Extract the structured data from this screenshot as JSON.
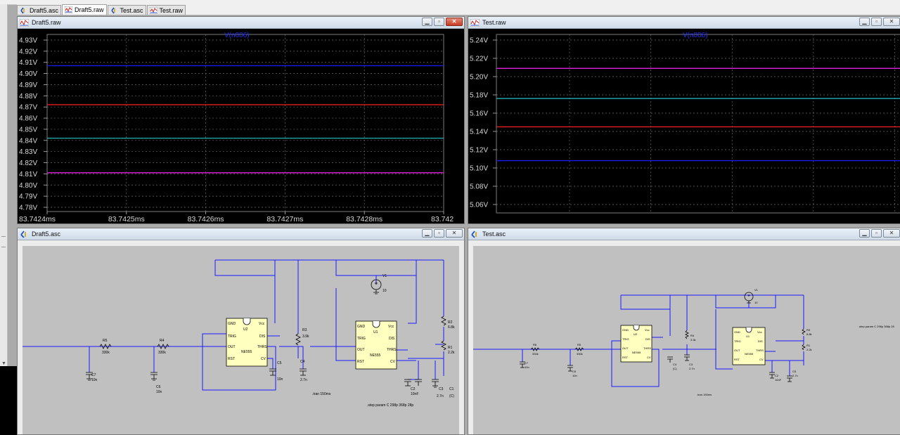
{
  "tabs": [
    {
      "label": "Draft5.asc",
      "icon": "schematic-icon",
      "active": false
    },
    {
      "label": "Draft5.raw",
      "icon": "waveform-icon",
      "active": true
    },
    {
      "label": "Test.asc",
      "icon": "schematic-icon",
      "active": false
    },
    {
      "label": "Test.raw",
      "icon": "waveform-icon",
      "active": false
    }
  ],
  "windows": {
    "draft5_raw": {
      "title": "Draft5.raw",
      "trace_label": "V(n006)"
    },
    "test_raw": {
      "title": "Test.raw",
      "trace_label": "V(n006)"
    },
    "draft5_asc": {
      "title": "Draft5.asc"
    },
    "test_asc": {
      "title": "Test.asc"
    }
  },
  "colors": {
    "trace_blue": "#1a1aff",
    "trace_red": "#ff2020",
    "trace_cyan": "#20b0b0",
    "trace_magenta": "#e020e0",
    "wire": "#1a1aff",
    "ic_fill": "#ffffbf",
    "background_plot": "#000000",
    "schematic_bg": "#c0c0c0"
  },
  "chart_data": [
    {
      "type": "line",
      "title": "V(n006)",
      "xlabel": "",
      "ylabel": "",
      "x_ticks": [
        "83.7424ms",
        "83.7425ms",
        "83.7426ms",
        "83.7427ms",
        "83.7428ms",
        "83.742"
      ],
      "y_ticks": [
        "4.93V",
        "4.92V",
        "4.91V",
        "4.90V",
        "4.89V",
        "4.88V",
        "4.87V",
        "4.86V",
        "4.85V",
        "4.84V",
        "4.83V",
        "4.82V",
        "4.81V",
        "4.80V",
        "4.79V",
        "4.78V"
      ],
      "ylim": [
        4.78,
        4.93
      ],
      "grid": true,
      "series": [
        {
          "color": "#1a1aff",
          "values": [
            4.907,
            4.907
          ]
        },
        {
          "color": "#ff2020",
          "values": [
            4.872,
            4.872
          ]
        },
        {
          "color": "#20b0b0",
          "values": [
            4.842,
            4.842
          ]
        },
        {
          "color": "#e020e0",
          "values": [
            4.811,
            4.811
          ]
        }
      ]
    },
    {
      "type": "line",
      "title": "V(n006)",
      "xlabel": "",
      "ylabel": "",
      "x_ticks": [],
      "y_ticks": [
        "5.24V",
        "5.22V",
        "5.20V",
        "5.18V",
        "5.16V",
        "5.14V",
        "5.12V",
        "5.10V",
        "5.08V",
        "5.06V"
      ],
      "ylim": [
        5.06,
        5.24
      ],
      "grid": true,
      "series": [
        {
          "color": "#e020e0",
          "values": [
            5.209,
            5.209
          ]
        },
        {
          "color": "#20b0b0",
          "values": [
            5.176,
            5.176
          ]
        },
        {
          "color": "#ff2020",
          "values": [
            5.145,
            5.145
          ]
        },
        {
          "color": "#1a1aff",
          "values": [
            5.108,
            5.108
          ]
        }
      ]
    }
  ],
  "schematic_left": {
    "ic_u2": {
      "name": "U2",
      "part": "NE555",
      "pins_left": [
        "GND",
        "TRIG",
        "OUT",
        "RST"
      ],
      "pins_right": [
        "Vcc",
        "DIS",
        "THRS",
        "CV"
      ]
    },
    "ic_u1": {
      "name": "U1",
      "part": "NE555",
      "pins_left": [
        "GND",
        "TRIG",
        "OUT",
        "RST"
      ],
      "pins_right": [
        "Vcc",
        "DIS",
        "THRS",
        "CV"
      ]
    },
    "components": [
      {
        "ref": "R5",
        "value": "330k"
      },
      {
        "ref": "R4",
        "value": "330k"
      },
      {
        "ref": "R3",
        "value": "3.9k"
      },
      {
        "ref": "R2",
        "value": "6.8k"
      },
      {
        "ref": "R1",
        "value": "2.2k"
      },
      {
        "ref": "C7",
        "value": "10n"
      },
      {
        "ref": "C6",
        "value": "10n"
      },
      {
        "ref": "C5",
        "value": "10n"
      },
      {
        "ref": "C4",
        "value": "2.7n"
      },
      {
        "ref": "C3",
        "value": "2.7n"
      },
      {
        "ref": "C2",
        "value": "10nF"
      },
      {
        "ref": "C1",
        "value": "(C)"
      },
      {
        "ref": "V1",
        "value": "10"
      }
    ],
    "directive_tran": ".tran 150ms",
    "directive_step": ".step param C 298p 368p 28p"
  },
  "schematic_right": {
    "ic_u2": {
      "name": "U2",
      "part": "NE555",
      "pins_left": [
        "GND",
        "TRIG",
        "OUT",
        "RST"
      ],
      "pins_right": [
        "Vcc",
        "DIS",
        "THRS",
        "CV"
      ]
    },
    "ic_u1": {
      "name": "U1",
      "part": "NE555",
      "pins_left": [
        "GND",
        "TRIG",
        "OUT",
        "RST"
      ],
      "pins_right": [
        "Vcc",
        "DIS",
        "THRS",
        "CV"
      ]
    },
    "components": [
      {
        "ref": "R6",
        "value": "330k"
      },
      {
        "ref": "R5",
        "value": "330k"
      },
      {
        "ref": "R4",
        "value": "3.3k"
      },
      {
        "ref": "R3",
        "value": "6.8k"
      },
      {
        "ref": "R1",
        "value": "2.2k"
      },
      {
        "ref": "C7",
        "value": "10n"
      },
      {
        "ref": "C6",
        "value": "10n"
      },
      {
        "ref": "C4",
        "value": "(C)"
      },
      {
        "ref": "C3",
        "value": "2.7n"
      },
      {
        "ref": "C2",
        "value": "10nF"
      },
      {
        "ref": "C5",
        "value": "2.7n"
      },
      {
        "ref": "V1",
        "value": "10"
      }
    ],
    "directive_tran": ".tran 150ms",
    "directive_step": ".step param C 298p 368p 28"
  }
}
